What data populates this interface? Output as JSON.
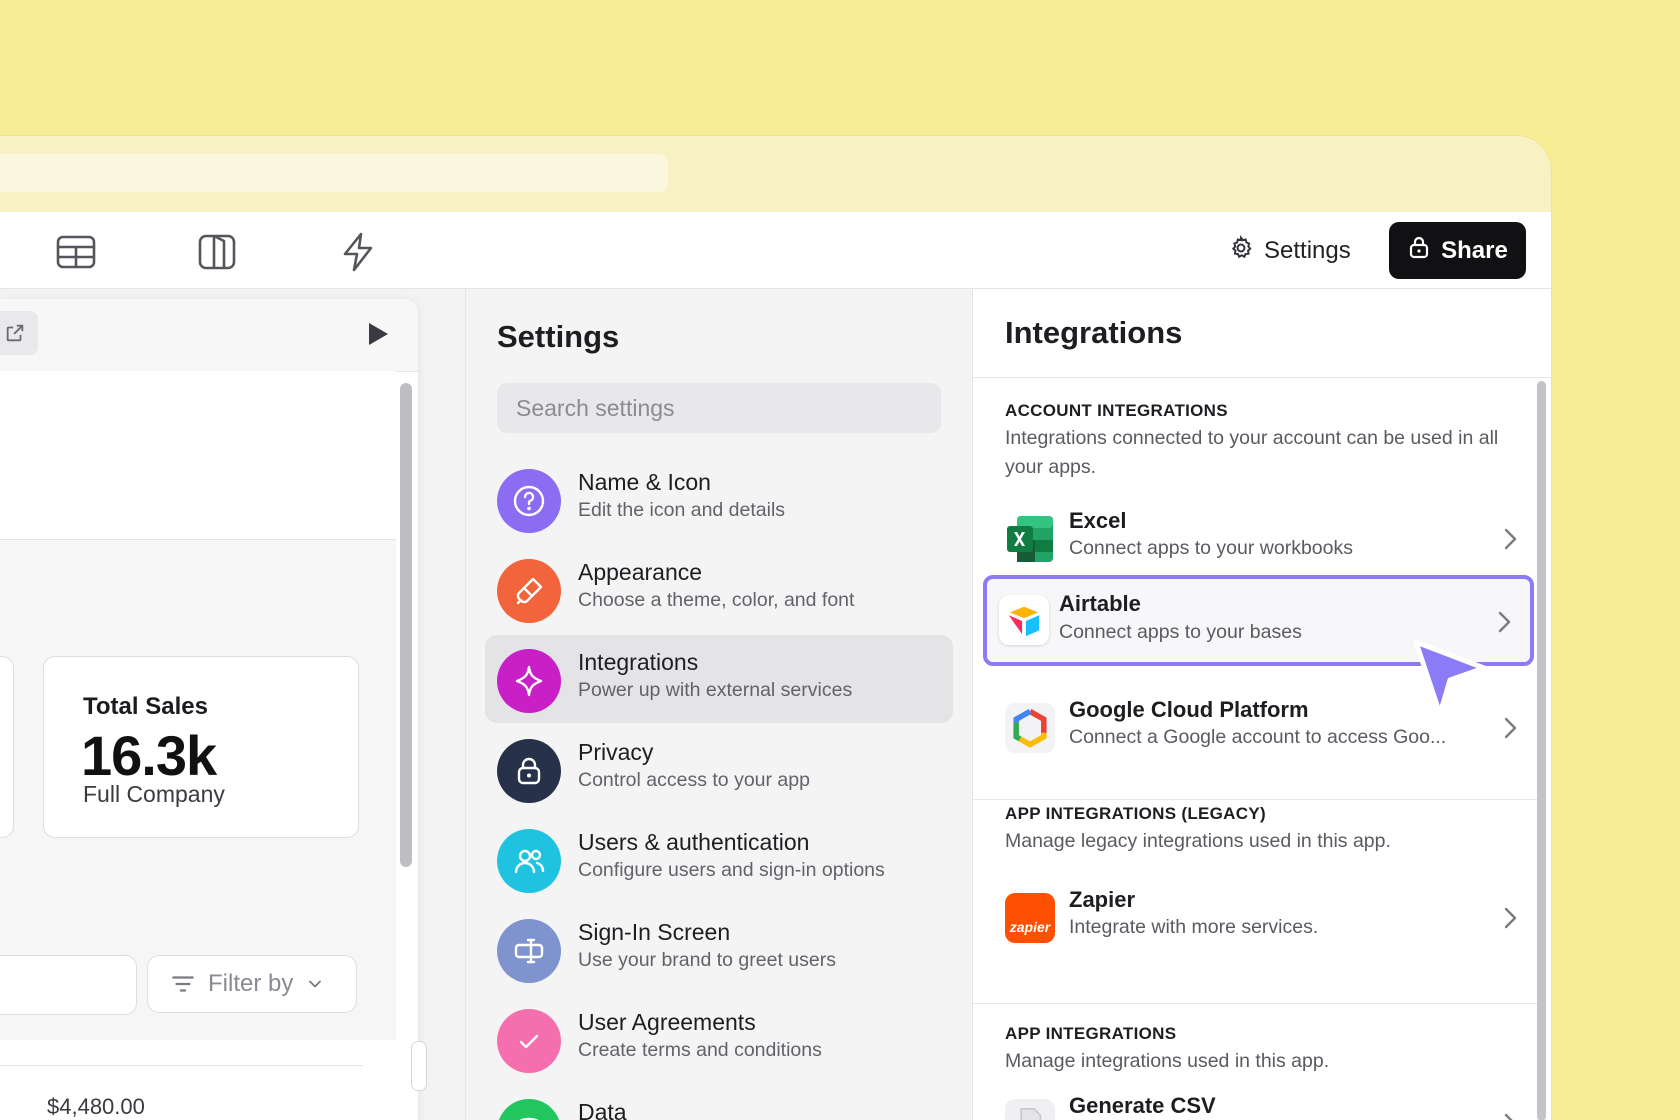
{
  "toolbar": {
    "settings_label": "Settings",
    "share_label": "Share",
    "icons": [
      "table-layout-icon",
      "split-view-icon",
      "lightning-icon"
    ]
  },
  "preview": {
    "kpi": {
      "title": "Total Sales",
      "value": "16.3k",
      "subtitle": "Full Company"
    },
    "filter_label": "Filter by",
    "list_price": "$4,480.00"
  },
  "settings": {
    "title": "Settings",
    "search_placeholder": "Search settings",
    "items": [
      {
        "label": "Name & Icon",
        "desc": "Edit the icon and details",
        "color": "#8b6cf3",
        "icon": "question-icon"
      },
      {
        "label": "Appearance",
        "desc": "Choose a theme, color, and font",
        "color": "#f2643b",
        "icon": "brush-icon"
      },
      {
        "label": "Integrations",
        "desc": "Power up with external services",
        "color": "#c91fc7",
        "icon": "sparkle-icon",
        "active": true
      },
      {
        "label": "Privacy",
        "desc": "Control access to your app",
        "color": "#27324a",
        "icon": "lock-icon"
      },
      {
        "label": "Users & authentication",
        "desc": "Configure users and sign-in options",
        "color": "#1fc3e0",
        "icon": "users-icon"
      },
      {
        "label": "Sign-In Screen",
        "desc": "Use your brand to greet users",
        "color": "#7f93cf",
        "icon": "sign-in-icon"
      },
      {
        "label": "User Agreements",
        "desc": "Create terms and conditions",
        "color": "#f56fae",
        "icon": "check-icon"
      },
      {
        "label": "Data",
        "desc": "",
        "color": "#22c55e",
        "icon": "data-icon"
      }
    ]
  },
  "integrations": {
    "title": "Integrations",
    "account": {
      "heading": "ACCOUNT INTEGRATIONS",
      "desc": "Integrations connected to your account can be used in all your apps.",
      "items": [
        {
          "name": "Excel",
          "desc": "Connect apps to your workbooks",
          "icon": "excel-logo-icon"
        },
        {
          "name": "Airtable",
          "desc": "Connect apps to your bases",
          "icon": "airtable-logo-icon",
          "highlight": true
        },
        {
          "name": "Google Cloud Platform",
          "desc": "Connect a Google account to access Goo...",
          "icon": "google-cloud-logo-icon"
        }
      ]
    },
    "legacy": {
      "heading": "APP INTEGRATIONS (LEGACY)",
      "desc": "Manage legacy integrations used in this app.",
      "items": [
        {
          "name": "Zapier",
          "desc": "Integrate with more services.",
          "icon": "zapier-logo-icon",
          "logo_text": "zapier"
        }
      ]
    },
    "app": {
      "heading": "APP INTEGRATIONS",
      "desc": "Manage integrations used in this app.",
      "items": [
        {
          "name": "Generate CSV",
          "desc": "",
          "icon": "csv-file-icon"
        }
      ]
    }
  },
  "colors": {
    "background": "#f8ec95",
    "accent_highlight": "#8b7bf7",
    "share_button": "#111114"
  }
}
